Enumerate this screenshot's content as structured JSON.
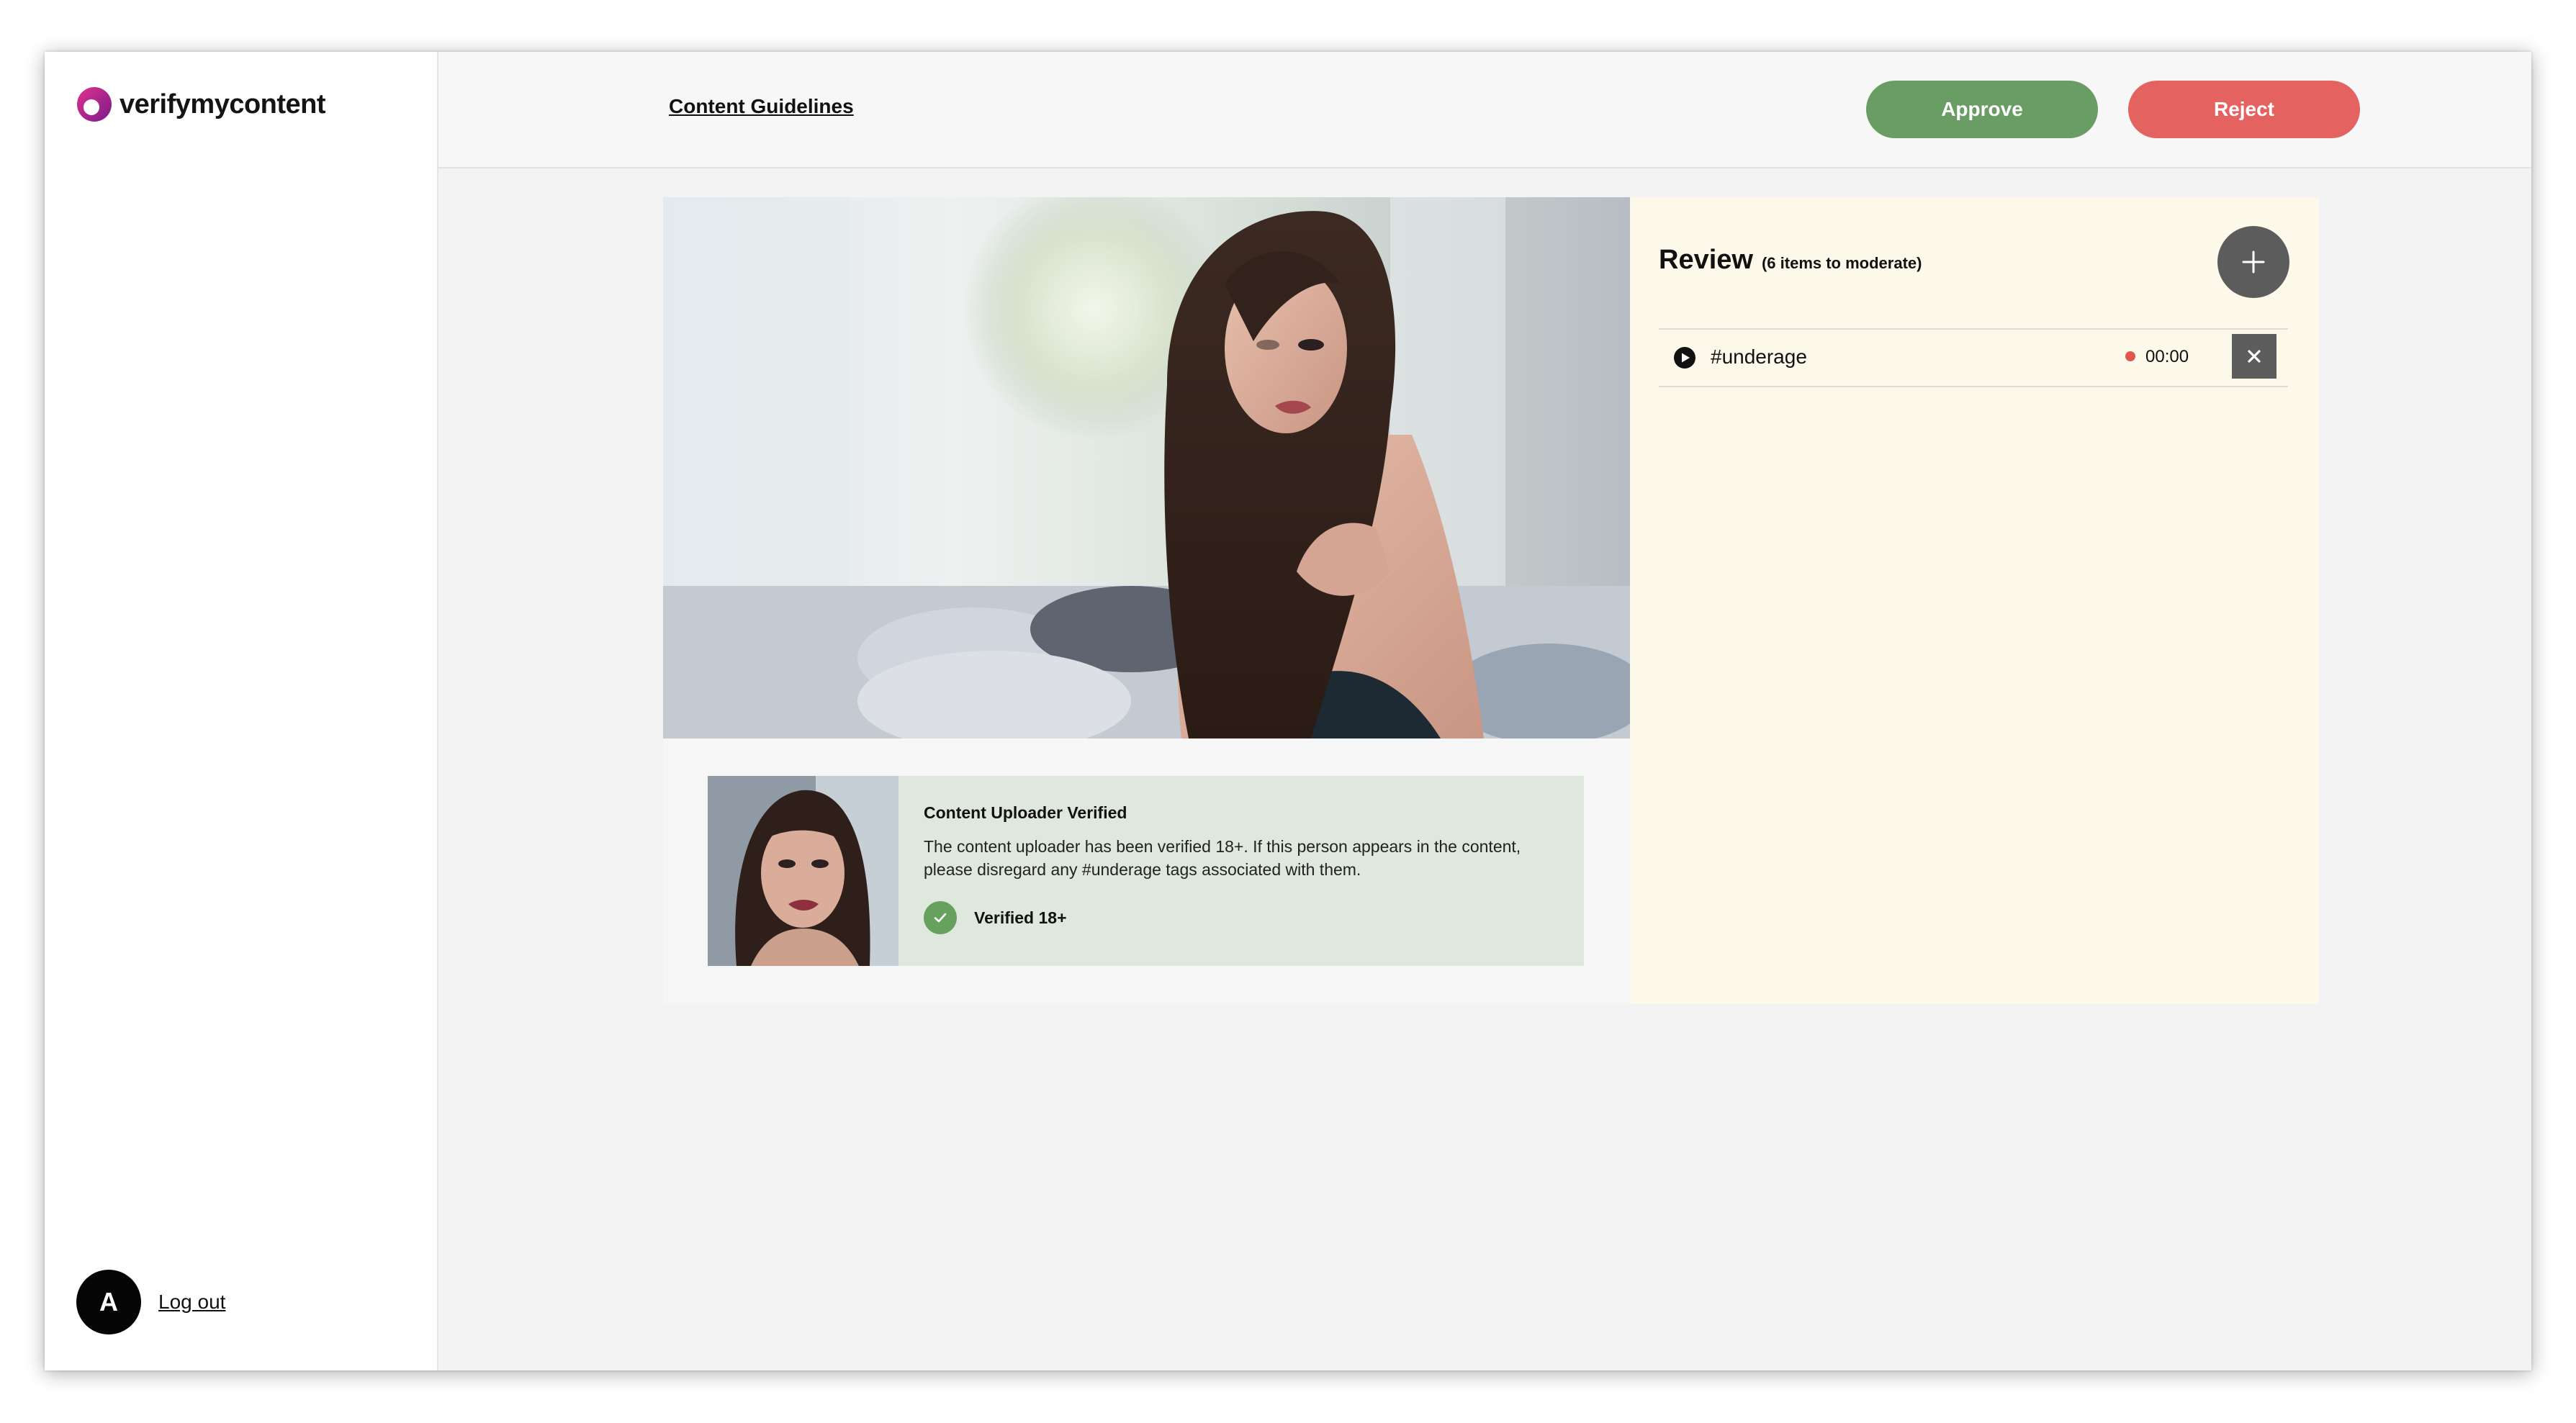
{
  "app": {
    "logo_text": "verifymycontent",
    "brand_color": "#c8137a"
  },
  "header": {
    "guidelines_link": "Content Guidelines",
    "approve_label": "Approve",
    "reject_label": "Reject",
    "approve_color": "#6a9d63",
    "reject_color": "#e4625f"
  },
  "user": {
    "avatar_initial": "A",
    "logout_label": "Log out"
  },
  "uploader": {
    "title": "Content Uploader Verified",
    "description": "The content uploader has been verified 18+. If this person appears in the content, please disregard any #underage tags associated with them.",
    "badge_label": "Verified 18+"
  },
  "review": {
    "title": "Review",
    "subtitle": "(6 items to moderate)",
    "items": [
      {
        "tag": "#underage",
        "time": "00:00"
      }
    ]
  },
  "icons": {
    "add": "plus-icon",
    "remove": "close-icon",
    "play": "play-icon",
    "check": "check-icon"
  }
}
